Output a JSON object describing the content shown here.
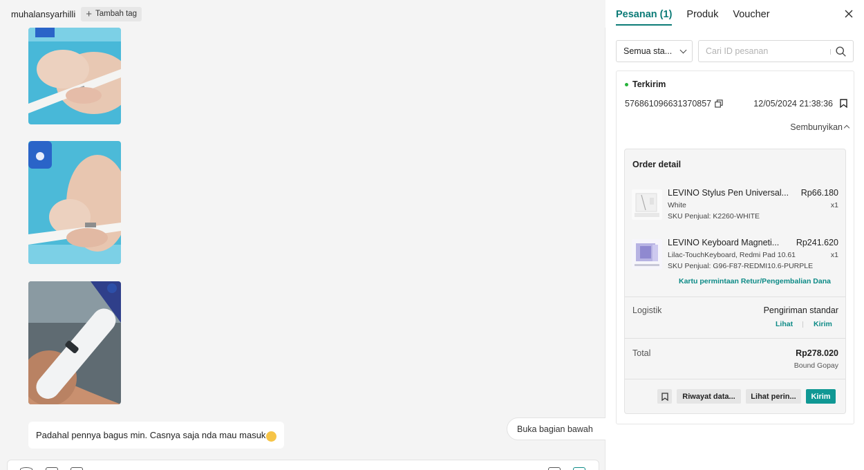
{
  "chat": {
    "username": "muhalansyarhilli",
    "tag_button_label": "Tambah tag",
    "message_text": "Padahal pennya bagus min. Casnya saja nda mau masuk",
    "scroll_bottom_label": "Buka bagian bawah",
    "icons": [
      "star-icon",
      "power-icon",
      "emoji-icon"
    ]
  },
  "panel": {
    "tabs": [
      {
        "label": "Pesanan (1)",
        "active": true
      },
      {
        "label": "Produk",
        "active": false
      },
      {
        "label": "Voucher",
        "active": false
      }
    ],
    "filter": {
      "selected": "Semua sta..."
    },
    "search": {
      "placeholder": "Cari ID pesanan"
    },
    "order": {
      "status": "Terkirim",
      "id": "576861096631370857",
      "date": "12/05/2024 21:38:36",
      "hide_label": "Sembunyikan",
      "detail_title": "Order detail",
      "items": [
        {
          "name": "LEVINO Stylus Pen Universal...",
          "price": "Rp66.180",
          "variant": "White",
          "qty": "x1",
          "sku": "SKU Penjual: K2260-WHITE"
        },
        {
          "name": "LEVINO Keyboard Magneti...",
          "price": "Rp241.620",
          "variant": "Lilac-TouchKeyboard, Redmi Pad 10.61",
          "qty": "x1",
          "sku": "SKU Penjual: G96-F87-REDMI10.6-PURPLE"
        }
      ],
      "return_link": "Kartu permintaan Retur/Pengembalian Dana",
      "logistics_label": "Logistik",
      "shipping_name": "Pengiriman standar",
      "ship_view": "Lihat",
      "ship_send": "Kirim",
      "total_label": "Total",
      "total_value": "Rp278.020",
      "payment": "Bound Gopay",
      "actions": {
        "history": "Riwayat data...",
        "view": "Lihat perin...",
        "send": "Kirim"
      }
    }
  },
  "colors": {
    "accent": "#0c7b77",
    "button_primary": "#109894",
    "status_dot": "#26b23a",
    "star": "#f0a500"
  }
}
